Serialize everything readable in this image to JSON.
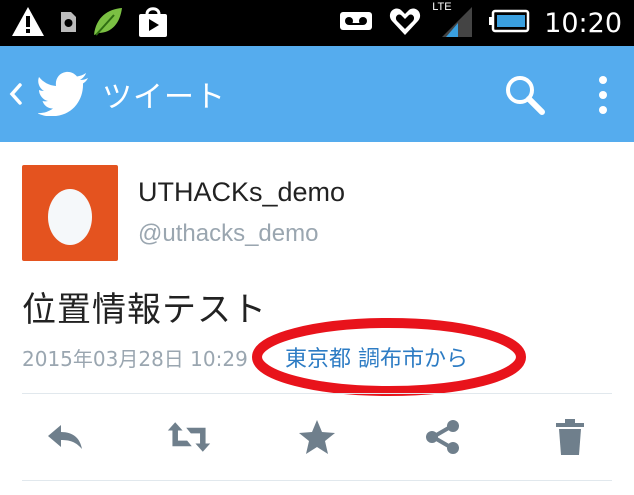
{
  "status_bar": {
    "time": "10:20",
    "network": "LTE",
    "icons": [
      "warning-icon",
      "sim-icon",
      "leaf-icon",
      "play-store-icon",
      "voicemail-icon",
      "heart-icon",
      "signal-icon",
      "battery-icon"
    ]
  },
  "app_bar": {
    "title": "ツイート",
    "icons": [
      "back-icon",
      "twitter-bird-icon",
      "search-icon",
      "overflow-menu-icon"
    ],
    "color": "#55acee"
  },
  "tweet": {
    "display_name": "UTHACKs_demo",
    "screen_name": "@uthacks_demo",
    "avatar_color": "#e4531f",
    "text": "位置情報テスト",
    "timestamp": "2015年03月28日 10:29",
    "location": "東京都 調布市から",
    "link_color": "#2d7cc4"
  },
  "actions": [
    "reply-icon",
    "retweet-icon",
    "favorite-icon",
    "share-icon",
    "delete-icon"
  ],
  "annotation": {
    "color": "#e8131b"
  }
}
